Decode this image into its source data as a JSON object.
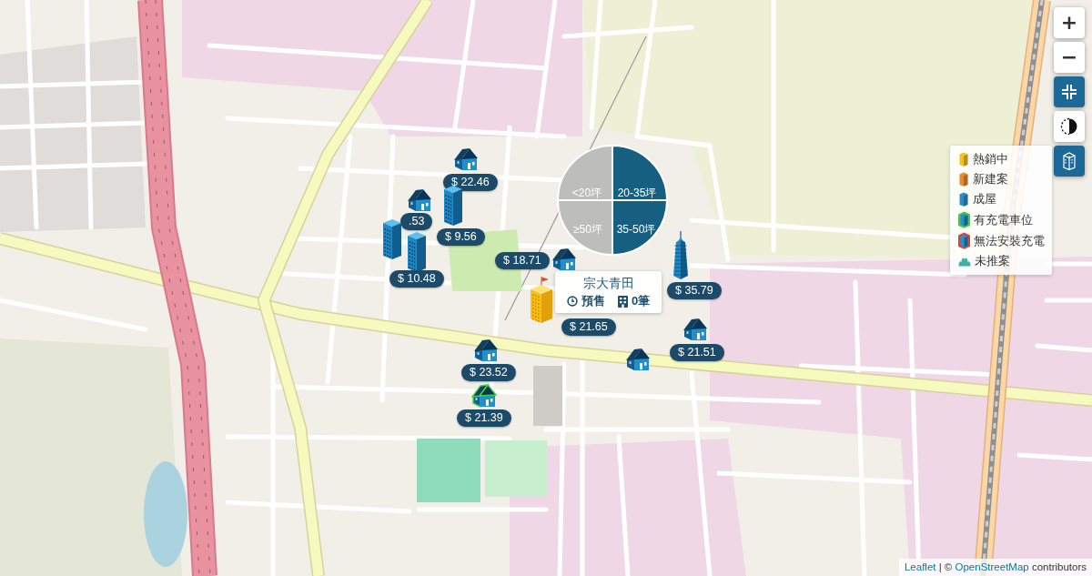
{
  "map": {
    "markers": [
      {
        "kind": "house",
        "price": "$ 22.46",
        "charging": false
      },
      {
        "kind": "house",
        "price": ".53",
        "charging": false
      },
      {
        "kind": "tower",
        "price": "$ 9.56",
        "charging": false
      },
      {
        "kind": "tower",
        "charging": false
      },
      {
        "kind": "tower",
        "price": "$ 10.48",
        "charging": false
      },
      {
        "kind": "house",
        "price": "$ 18.71",
        "charging": false
      },
      {
        "kind": "skyscraper",
        "price": "$ 35.79",
        "charging": false
      },
      {
        "kind": "flag-building",
        "price": "$ 21.65",
        "charging": false
      },
      {
        "kind": "house",
        "price": "$ 21.51",
        "charging": false
      },
      {
        "kind": "house",
        "price": "$ 23.52",
        "charging": false
      },
      {
        "kind": "house",
        "charging": false
      },
      {
        "kind": "house",
        "price": "$ 21.39",
        "charging": true
      }
    ]
  },
  "size_filter": {
    "slices": [
      {
        "label": "<20坪",
        "selected": false
      },
      {
        "label": "20-35坪",
        "selected": true
      },
      {
        "label": "≥50坪",
        "selected": false
      },
      {
        "label": "35-50坪",
        "selected": true
      }
    ]
  },
  "popup": {
    "title": "宗大青田",
    "status": "預售",
    "units": "0筆"
  },
  "map_controls": [
    {
      "kind": "zoom-in",
      "label": "+",
      "active": false
    },
    {
      "kind": "zoom-out",
      "label": "−",
      "active": false
    },
    {
      "kind": "collapse",
      "active": true
    },
    {
      "kind": "contrast",
      "active": false
    },
    {
      "kind": "buildings",
      "active": true
    }
  ],
  "legend": {
    "items": [
      {
        "kind": "building",
        "label": "熱銷中",
        "color": "#f3c21c"
      },
      {
        "kind": "building",
        "label": "新建案",
        "color": "#e8892b"
      },
      {
        "kind": "building",
        "label": "成屋",
        "color": "#2a8fc9"
      },
      {
        "kind": "outlined",
        "label": "有充電車位",
        "color": "#3fcf3f"
      },
      {
        "kind": "outlined",
        "label": "無法安裝充電",
        "color": "#d9453a"
      },
      {
        "kind": "grass",
        "label": "未推案",
        "color": "#3bb3a4"
      }
    ]
  },
  "attribution": {
    "parts": [
      {
        "kind": "link",
        "text": "Leaflet"
      },
      {
        "kind": "text",
        "text": " | © "
      },
      {
        "kind": "link",
        "text": "OpenStreetMap"
      },
      {
        "kind": "text",
        "text": " contributors"
      }
    ]
  }
}
